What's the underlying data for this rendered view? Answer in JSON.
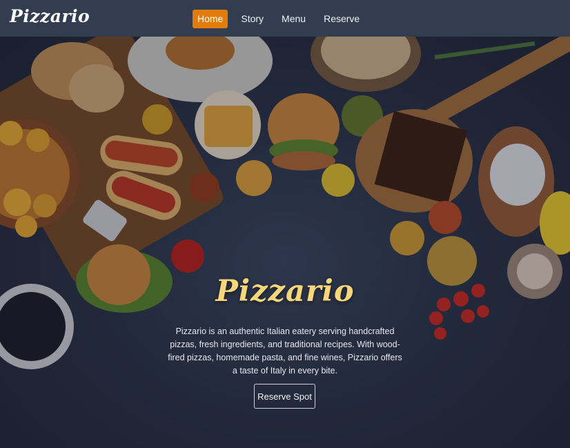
{
  "navbar": {
    "brand": "Pizzario",
    "items": [
      {
        "label": "Home",
        "active": true
      },
      {
        "label": "Story",
        "active": false
      },
      {
        "label": "Menu",
        "active": false
      },
      {
        "label": "Reserve",
        "active": false
      }
    ]
  },
  "hero": {
    "title": "Pizzario",
    "description": "Pizzario is an authentic Italian eatery serving handcrafted pizzas, fresh ingredients, and traditional recipes. With wood-fired pizzas, homemade pasta, and fine wines, Pizzario offers a taste of Italy in every bite.",
    "cta_label": "Reserve Spot",
    "background_image": "food-flatlay-background"
  },
  "colors": {
    "nav_bg": "#323d50",
    "accent": "#e07b0c",
    "title_gold": "#f6d77a",
    "hero_bg": "#2a3142"
  }
}
